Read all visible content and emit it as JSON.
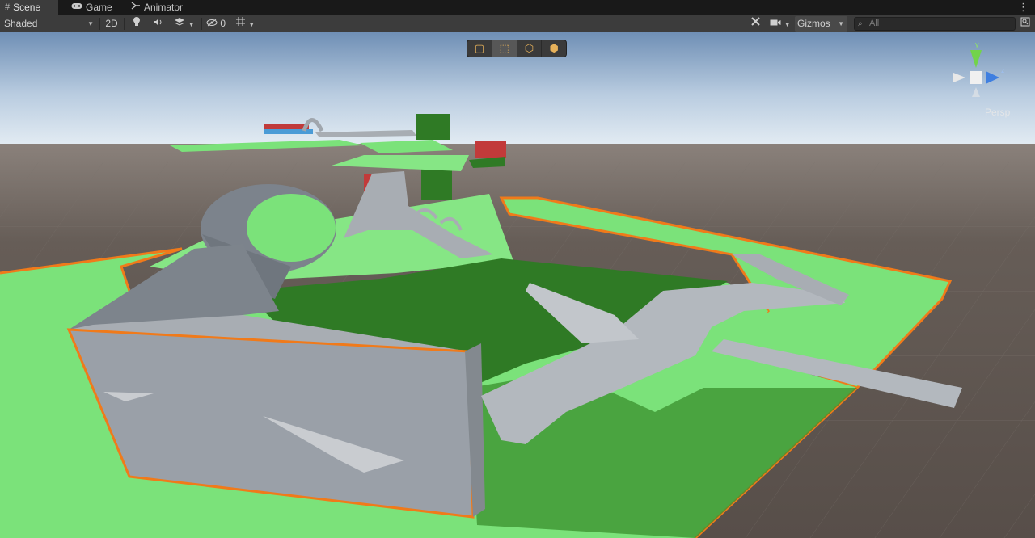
{
  "tabs": [
    {
      "label": "Scene",
      "icon": "hash-icon",
      "active": true
    },
    {
      "label": "Game",
      "icon": "gamepad-icon",
      "active": false
    },
    {
      "label": "Animator",
      "icon": "animator-icon",
      "active": false
    }
  ],
  "toolbar": {
    "shading_mode": "Shaded",
    "mode_2d": "2D",
    "hidden_count": "0",
    "gizmos_label": "Gizmos",
    "search_placeholder": "All"
  },
  "viewport": {
    "projection_label": "Persp",
    "axis_y": "y",
    "axis_z": "z",
    "sky_top": "#6f8fb5",
    "sky_horizon": "#e3ecf3",
    "ground": "#5f5651",
    "grass": "#7be27a",
    "dark_grass": "#2f7a25",
    "selection_outline": "#f07a1a",
    "wall_grey": "#9aa0a8"
  },
  "scene_tools": [
    {
      "name": "box-tool",
      "active": false
    },
    {
      "name": "rect-tool",
      "active": true
    },
    {
      "name": "wire-box-tool",
      "active": false
    },
    {
      "name": "solid-box-tool",
      "active": false
    }
  ]
}
